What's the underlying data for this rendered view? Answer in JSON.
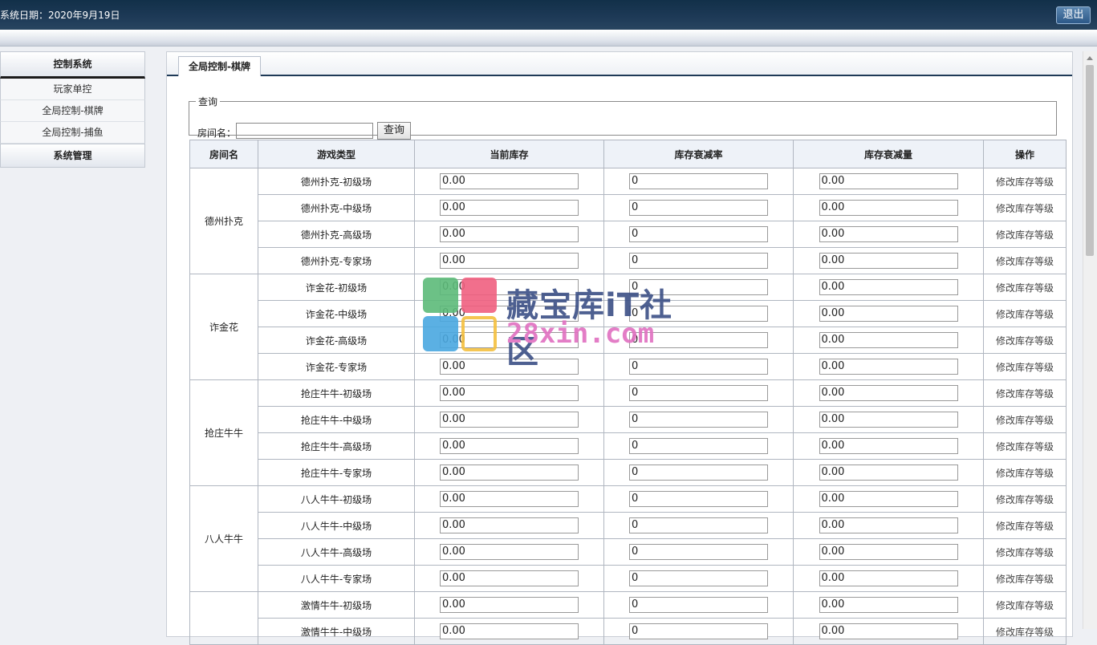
{
  "header": {
    "system_date": "系统日期：2020年9月19日",
    "logout_label": "退出"
  },
  "sidebar": {
    "section1": "控制系统",
    "items": [
      "玩家单控",
      "全局控制-棋牌",
      "全局控制-捕鱼"
    ],
    "section2": "系统管理"
  },
  "tab": {
    "label": "全局控制-棋牌"
  },
  "query": {
    "legend": "查询",
    "room_label": "房间名：",
    "room_value": "",
    "button_label": "查询"
  },
  "table": {
    "headers": [
      "房间名",
      "游戏类型",
      "当前库存",
      "库存衰减率",
      "库存衰减量",
      "操作"
    ],
    "action_label": "修改库存等级",
    "groups": [
      {
        "room": "德州扑克",
        "rows": [
          {
            "type": "德州扑克-初级场",
            "stock": "0.00",
            "rate": "0",
            "amount": "0.00"
          },
          {
            "type": "德州扑克-中级场",
            "stock": "0.00",
            "rate": "0",
            "amount": "0.00"
          },
          {
            "type": "德州扑克-高级场",
            "stock": "0.00",
            "rate": "0",
            "amount": "0.00"
          },
          {
            "type": "德州扑克-专家场",
            "stock": "0.00",
            "rate": "0",
            "amount": "0.00"
          }
        ]
      },
      {
        "room": "诈金花",
        "rows": [
          {
            "type": "诈金花-初级场",
            "stock": "0.00",
            "rate": "0",
            "amount": "0.00"
          },
          {
            "type": "诈金花-中级场",
            "stock": "0.00",
            "rate": "0",
            "amount": "0.00"
          },
          {
            "type": "诈金花-高级场",
            "stock": "0.00",
            "rate": "0",
            "amount": "0.00"
          },
          {
            "type": "诈金花-专家场",
            "stock": "0.00",
            "rate": "0",
            "amount": "0.00"
          }
        ]
      },
      {
        "room": "抢庄牛牛",
        "rows": [
          {
            "type": "抢庄牛牛-初级场",
            "stock": "0.00",
            "rate": "0",
            "amount": "0.00"
          },
          {
            "type": "抢庄牛牛-中级场",
            "stock": "0.00",
            "rate": "0",
            "amount": "0.00"
          },
          {
            "type": "抢庄牛牛-高级场",
            "stock": "0.00",
            "rate": "0",
            "amount": "0.00"
          },
          {
            "type": "抢庄牛牛-专家场",
            "stock": "0.00",
            "rate": "0",
            "amount": "0.00"
          }
        ]
      },
      {
        "room": "八人牛牛",
        "rows": [
          {
            "type": "八人牛牛-初级场",
            "stock": "0.00",
            "rate": "0",
            "amount": "0.00"
          },
          {
            "type": "八人牛牛-中级场",
            "stock": "0.00",
            "rate": "0",
            "amount": "0.00"
          },
          {
            "type": "八人牛牛-高级场",
            "stock": "0.00",
            "rate": "0",
            "amount": "0.00"
          },
          {
            "type": "八人牛牛-专家场",
            "stock": "0.00",
            "rate": "0",
            "amount": "0.00"
          }
        ]
      },
      {
        "room": "",
        "rows": [
          {
            "type": "激情牛牛-初级场",
            "stock": "0.00",
            "rate": "0",
            "amount": "0.00"
          },
          {
            "type": "激情牛牛-中级场",
            "stock": "0.00",
            "rate": "0",
            "amount": "0.00"
          }
        ]
      }
    ]
  },
  "watermark": {
    "line1": "藏宝库iT社区",
    "line2": "28xin.com"
  }
}
